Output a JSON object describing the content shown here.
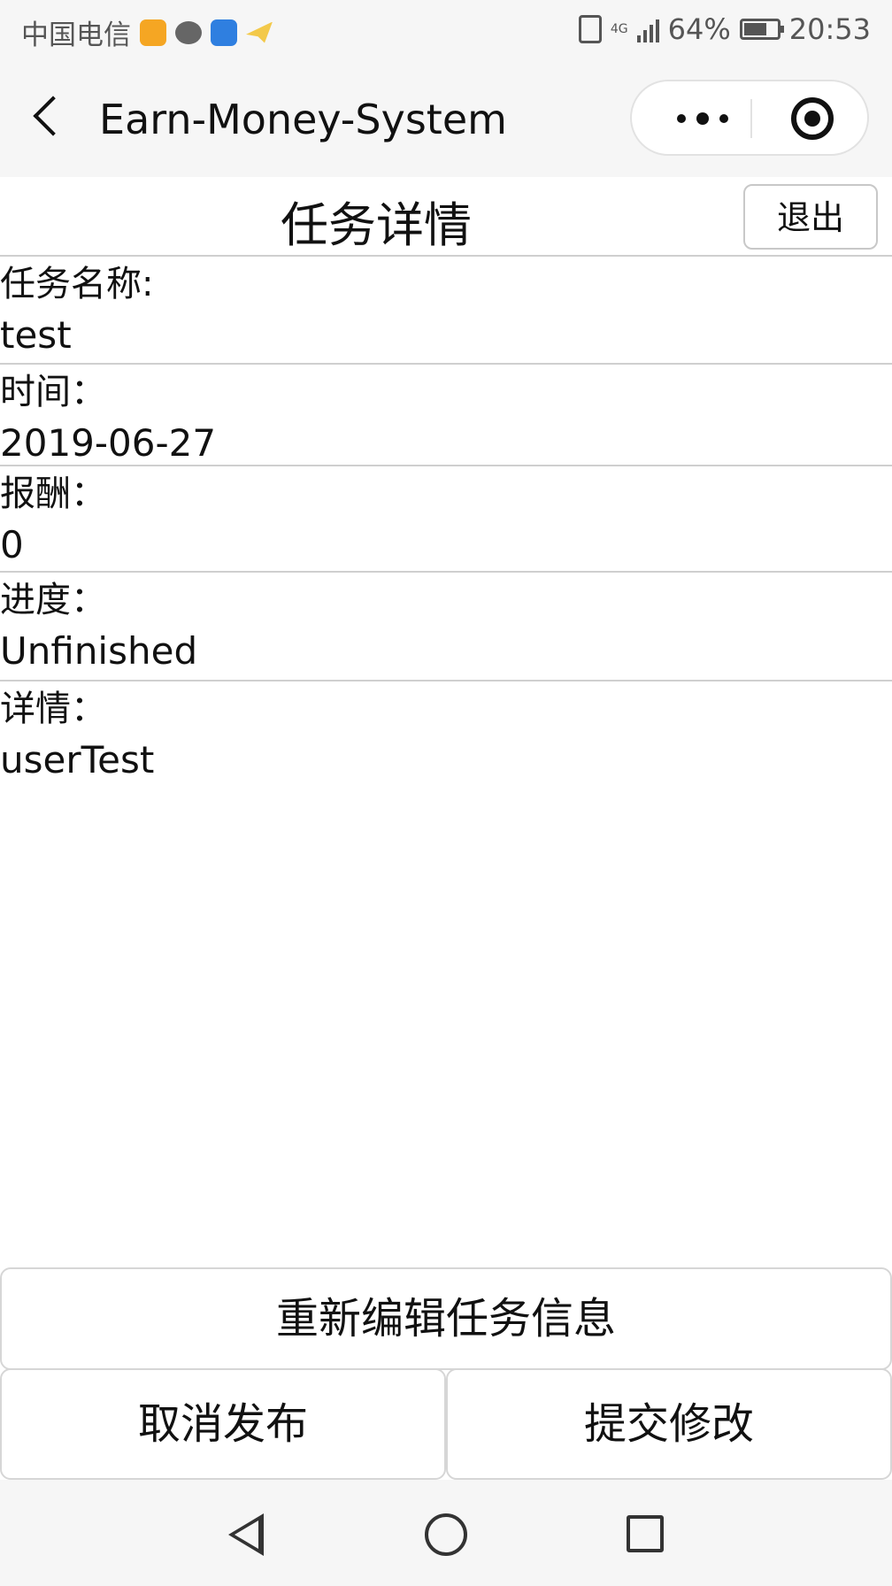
{
  "status_bar": {
    "carrier": "中国电信",
    "network": "4G",
    "battery_percent": "64%",
    "time": "20:53",
    "icons": [
      "app-notification-icon",
      "chat-icon",
      "shield-icon",
      "plane-icon",
      "vibrate-icon",
      "signal-icon",
      "battery-icon"
    ]
  },
  "nav_bar": {
    "title": "Earn-Money-System",
    "icons": [
      "back-icon",
      "more-icon",
      "target-icon"
    ]
  },
  "page": {
    "title": "任务详情",
    "exit_label": "退出",
    "fields": [
      {
        "label": "任务名称:",
        "value": "test"
      },
      {
        "label": "时间：",
        "value": "2019-06-27"
      },
      {
        "label": "报酬：",
        "value": "0"
      },
      {
        "label": "进度：",
        "value": "Unfinished"
      },
      {
        "label": "详情：",
        "value": "userTest"
      }
    ],
    "buttons": {
      "edit": "重新编辑任务信息",
      "cancel": "取消发布",
      "submit": "提交修改"
    }
  },
  "colors": {
    "background": "#f6f6f6",
    "content_background": "#ffffff",
    "divider": "#cfcfcf",
    "text": "#111111"
  }
}
